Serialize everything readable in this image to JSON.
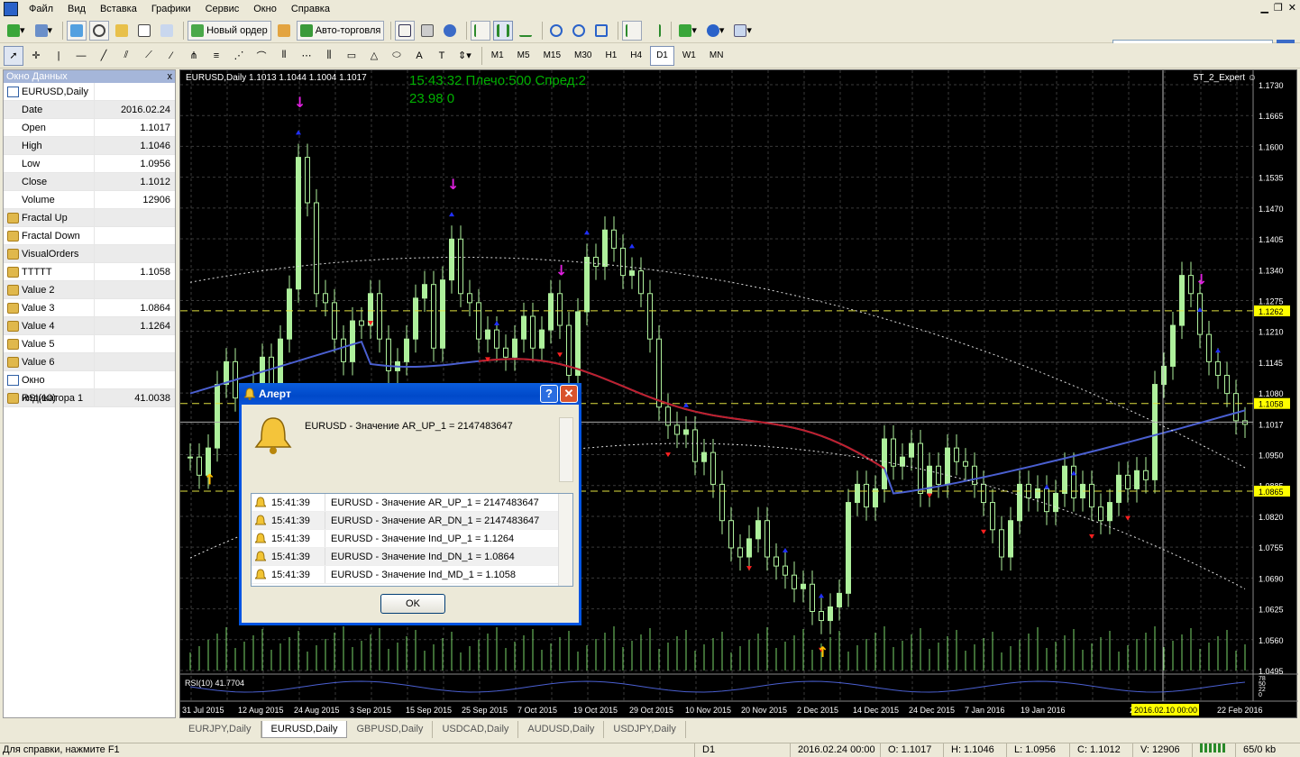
{
  "menu": {
    "items": [
      "Файл",
      "Вид",
      "Вставка",
      "Графики",
      "Сервис",
      "Окно",
      "Справка"
    ]
  },
  "toolbar": {
    "new_order": "Новый ордер",
    "autotrading": "Авто-торговля",
    "timeframes": [
      "M1",
      "M5",
      "M15",
      "M30",
      "H1",
      "H4",
      "D1",
      "W1",
      "MN"
    ],
    "active_tf": "D1"
  },
  "datawindow": {
    "title": "Окно Данных",
    "close": "x",
    "rows": [
      {
        "label": "EURUSD,Daily",
        "value": "",
        "icon": "chart"
      },
      {
        "label": "Date",
        "value": "2016.02.24"
      },
      {
        "label": "Open",
        "value": "1.1017"
      },
      {
        "label": "High",
        "value": "1.1046"
      },
      {
        "label": "Low",
        "value": "1.0956"
      },
      {
        "label": "Close",
        "value": "1.1012"
      },
      {
        "label": "Volume",
        "value": "12906"
      },
      {
        "label": "Fractal Up",
        "value": "",
        "icon": "ind"
      },
      {
        "label": "Fractal Down",
        "value": "",
        "icon": "ind"
      },
      {
        "label": "VisualOrders",
        "value": "",
        "icon": "ind"
      },
      {
        "label": "TTTTT",
        "value": "1.1058",
        "icon": "ind"
      },
      {
        "label": "Value 2",
        "value": "",
        "icon": "ind"
      },
      {
        "label": "Value 3",
        "value": "1.0864",
        "icon": "ind"
      },
      {
        "label": "Value 4",
        "value": "1.1264",
        "icon": "ind"
      },
      {
        "label": "Value 5",
        "value": "",
        "icon": "ind"
      },
      {
        "label": "Value 6",
        "value": "",
        "icon": "ind"
      },
      {
        "label": "Окно индикатора 1",
        "value": "",
        "icon": "chart"
      },
      {
        "label": "RSI(10)",
        "value": "41.0038",
        "icon": "ind"
      }
    ]
  },
  "chart": {
    "info": "EURUSD,Daily  1.1013 1.1044 1.1004 1.1017",
    "green_line1": "15:43:32 Плечо:500 Спред:2",
    "green_line2": "23.98        0",
    "expert": "5T_2_Expert ☺",
    "rsi_label": "RSI(10) 41.7704",
    "price_labels": [
      "1.1730",
      "1.1665",
      "1.1600",
      "1.1535",
      "1.1470",
      "1.1405",
      "1.1340",
      "1.1275",
      "1.1210",
      "1.1145",
      "1.1080",
      "1.1017",
      "1.0950",
      "1.0885",
      "1.0820",
      "1.0755",
      "1.0690",
      "1.0625",
      "1.0560",
      "1.0495"
    ],
    "highlight_labels": {
      "h1": "1.1262",
      "h2": "1.1058",
      "h3": "1.0865"
    },
    "rsi_scale": [
      "78",
      "50",
      "22",
      "0"
    ],
    "date_labels": [
      "31 Jul 2015",
      "12 Aug 2015",
      "24 Aug 2015",
      "3 Sep 2015",
      "15 Sep 2015",
      "25 Sep 2015",
      "7 Oct 2015",
      "19 Oct 2015",
      "29 Oct 2015",
      "10 Nov 2015",
      "20 Nov 2015",
      "2 Dec 2015",
      "14 Dec 2015",
      "24 Dec 2015",
      "7 Jan 2016",
      "19 Jan 2016",
      "29 Jan",
      "2016.02.10 00:00",
      "22 Feb 2016"
    ]
  },
  "tabs": [
    "EURJPY,Daily",
    "EURUSD,Daily",
    "GBPUSD,Daily",
    "USDCAD,Daily",
    "AUDUSD,Daily",
    "USDJPY,Daily"
  ],
  "active_tab": "EURUSD,Daily",
  "status": {
    "help": "Для справки, нажмите F1",
    "tf": "D1",
    "date": "2016.02.24 00:00",
    "open": "O: 1.1017",
    "high": "H: 1.1046",
    "low": "L: 1.0956",
    "close": "C: 1.1012",
    "vol": "V: 12906",
    "traffic": "65/0 kb"
  },
  "alert": {
    "title": "Алерт",
    "help": "?",
    "close": "✕",
    "message": "EURUSD - Значение AR_UP_1 = 2147483647",
    "rows": [
      {
        "time": "15:41:39",
        "msg": "EURUSD - Значение AR_UP_1 = 2147483647"
      },
      {
        "time": "15:41:39",
        "msg": "EURUSD - Значение AR_DN_1 = 2147483647"
      },
      {
        "time": "15:41:39",
        "msg": "EURUSD - Значение Ind_UP_1 = 1.1264"
      },
      {
        "time": "15:41:39",
        "msg": "EURUSD - Значение Ind_DN_1 = 1.0864"
      },
      {
        "time": "15:41:39",
        "msg": "EURUSD - Значение Ind_MD_1 = 1.1058"
      }
    ],
    "ok": "OK"
  },
  "colors": {
    "candle": "#aef09c",
    "ma_red": "#c0202a",
    "ma_blue": "#4a5fd0",
    "fractal_up": "#2030ff",
    "fractal_down": "#ff2020",
    "arrow_magenta": "#e020e0",
    "arrow_yellow": "#ffc000",
    "hline_yellow": "#e0e040"
  }
}
